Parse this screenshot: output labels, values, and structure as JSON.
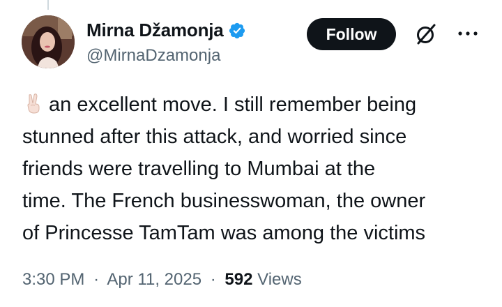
{
  "author": {
    "display_name": "Mirna Džamonja",
    "handle": "@MirnaDzamonja",
    "verified": true,
    "verified_color": "#1d9bf0"
  },
  "actions": {
    "follow_label": "Follow",
    "grok_icon": "grok-icon",
    "more_icon": "more-icon"
  },
  "tweet": {
    "emoji": "victory-hand-icon",
    "lines": [
      "an excellent move. I still remember being",
      "stunned after this attack, and worried since",
      "friends were travelling to Mumbai at the",
      "time. The French businesswoman, the owner",
      "of Princesse TamTam was among the victims"
    ]
  },
  "meta": {
    "time": "3:30 PM",
    "separator": "·",
    "date": "Apr 11, 2025",
    "views_count": "592",
    "views_label": "Views"
  },
  "colors": {
    "text_primary": "#0f1419",
    "text_secondary": "#536471",
    "follow_bg": "#0f1419"
  }
}
